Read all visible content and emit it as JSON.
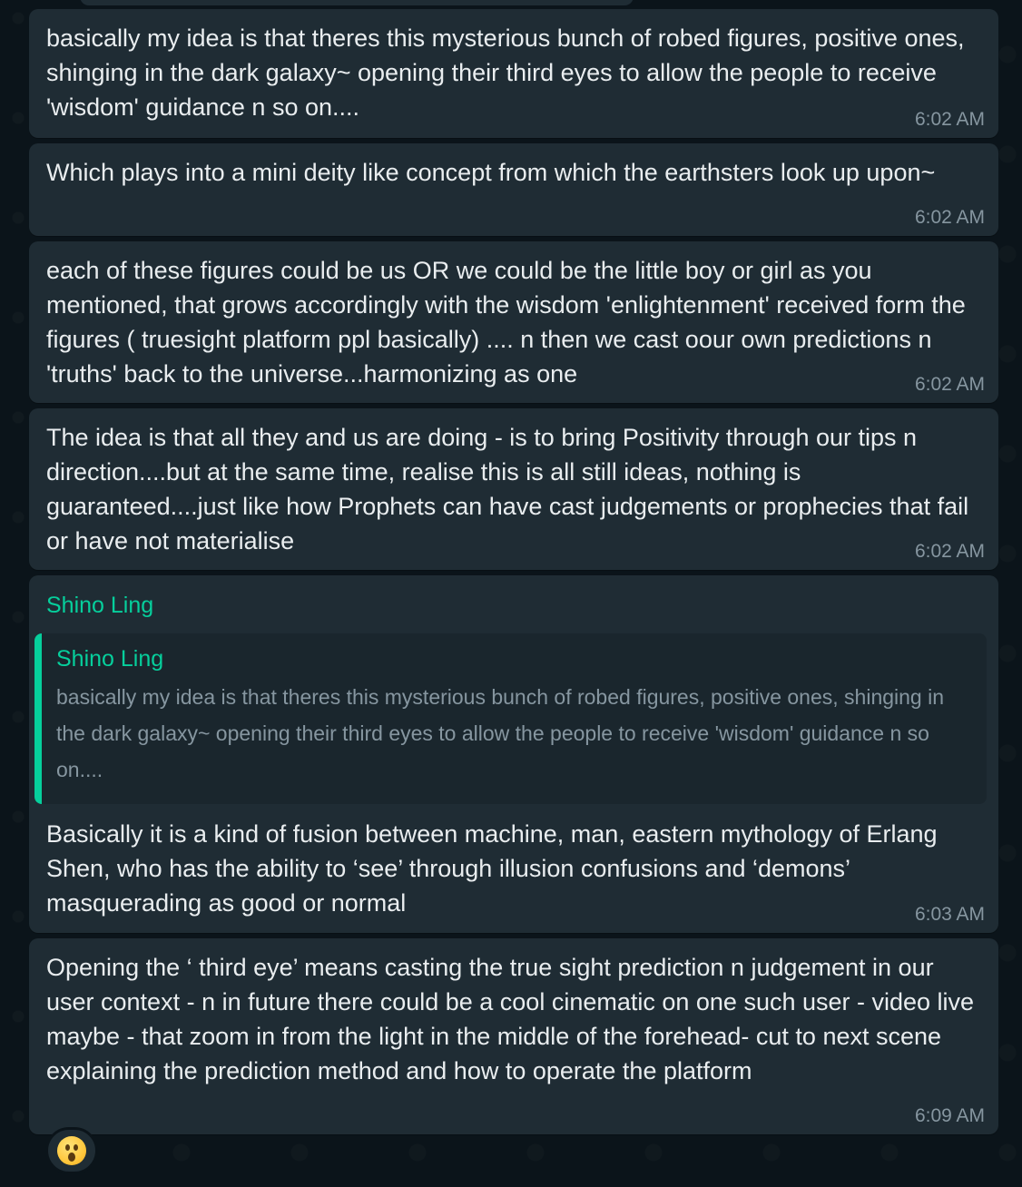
{
  "messages": [
    {
      "text": "basically my idea is that theres this mysterious bunch of robed figures, positive ones, shinging in the dark galaxy~ opening their third eyes to allow the people to receive 'wisdom' guidance n so on....",
      "time": "6:02 AM"
    },
    {
      "text": "Which plays into a mini deity like concept from which the earthsters look up upon~",
      "time": "6:02 AM"
    },
    {
      "text": "each of these figures could be us OR we could be the little boy or girl as you mentioned, that grows accordingly with the wisdom 'enlightenment' received form the figures ( truesight platform ppl basically) .... n then we cast oour own predictions n 'truths' back to the universe...harmonizing as one",
      "time": "6:02 AM"
    },
    {
      "text": "The idea is that all they and us are doing - is to bring Positivity through our tips n direction....but at the same time, realise this is all still ideas, nothing is guaranteed....just like how Prophets can have cast judgements or prophecies that fail or have not materialise",
      "time": "6:02 AM"
    },
    {
      "sender": "Shino Ling",
      "quote": {
        "sender": "Shino Ling",
        "text": "basically my idea is that theres this mysterious bunch of robed figures, positive ones, shinging in the dark galaxy~ opening their third eyes to allow the people to receive 'wisdom' guidance n so on...."
      },
      "text": "Basically it is a kind of fusion between machine, man, eastern mythology of Erlang Shen, who has the ability to ‘see’ through illusion confusions and ‘demons’ masquerading as good or normal",
      "time": "6:03 AM"
    },
    {
      "text": "Opening the ‘ third eye’ means casting the true sight prediction n judgement in our user context - n in future there could be a cool cinematic on one such user - video live maybe - that zoom in from the light in the middle of the forehead- cut to next scene explaining the prediction method and how to operate the platform",
      "time": "6:09 AM",
      "reaction": "hushed-face-emoji"
    }
  ],
  "colors": {
    "background": "#0b141a",
    "bubble": "#1f2c34",
    "quote_background": "#1a262d",
    "accent": "#06cf9c",
    "text": "#e9edef",
    "meta": "#8696a0"
  }
}
